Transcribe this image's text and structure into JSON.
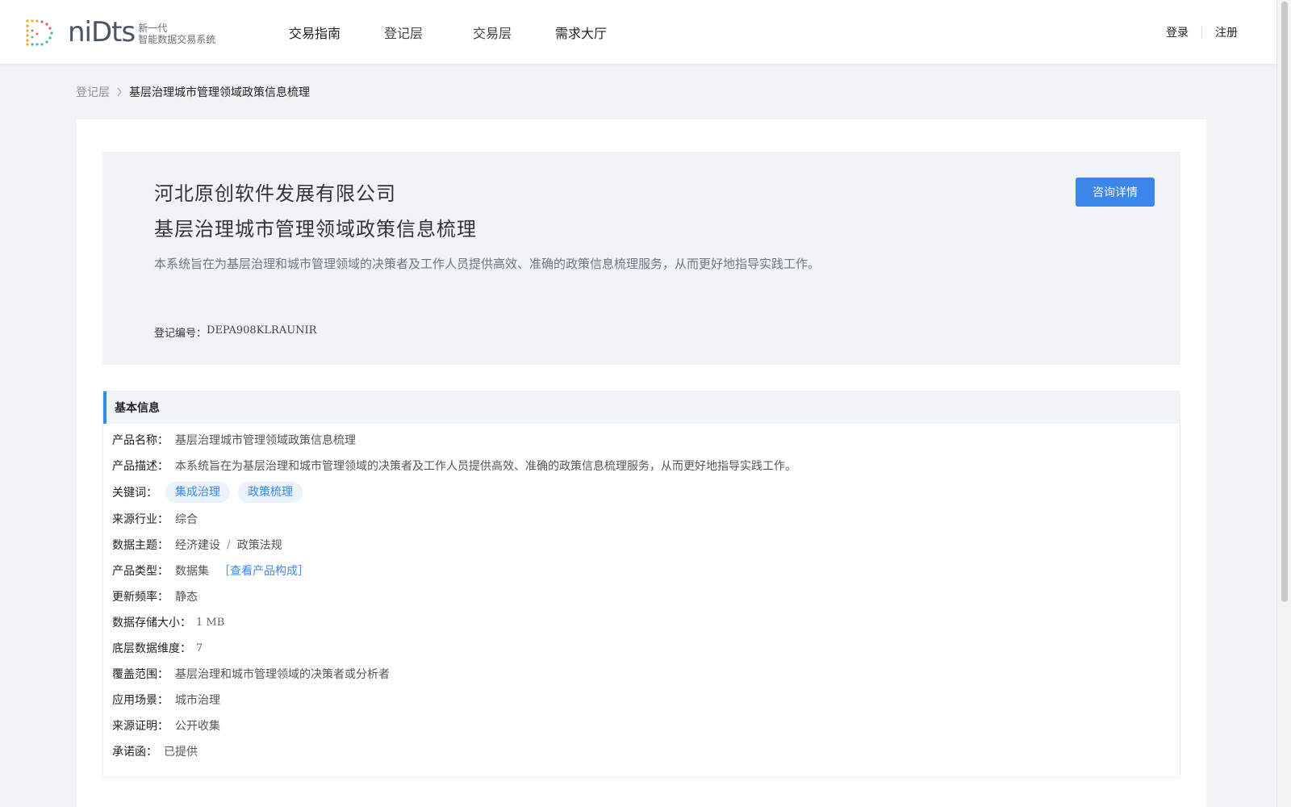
{
  "header": {
    "logo": {
      "icon": "dotted-d-logo-icon",
      "word": "niDts",
      "sub_line1": "新一代",
      "sub_line2": "智能数据交易系统"
    },
    "nav": [
      "交易指南",
      "登记层",
      "交易层",
      "需求大厅"
    ],
    "auth": {
      "login": "登录",
      "register": "注册"
    }
  },
  "breadcrumb": {
    "parent": "登记层",
    "current": "基层治理城市管理领域政策信息梳理",
    "separator_icon": "chevron-right-icon"
  },
  "hero": {
    "company": "河北原创软件发展有限公司",
    "title": "基层治理城市管理领域政策信息梳理",
    "description": "本系统旨在为基层治理和城市管理领域的决策者及工作人员提供高效、准确的政策信息梳理服务，从而更好地指导实践工作。",
    "reg_label": "登记编号：",
    "reg_code": "DEPA908KLRAUNIR",
    "consult_button": "咨询详情"
  },
  "basic_info": {
    "section_title": "基本信息",
    "product_name_label": "产品名称：",
    "product_name": "基层治理城市管理领域政策信息梳理",
    "product_desc_label": "产品描述：",
    "product_desc": "本系统旨在为基层治理和城市管理领域的决策者及工作人员提供高效、准确的政策信息梳理服务，从而更好地指导实践工作。",
    "keywords_label": "关键词：",
    "keywords": [
      "集成治理",
      "政策梳理"
    ],
    "industry_label": "来源行业：",
    "industry": "综合",
    "theme_label": "数据主题：",
    "theme_primary": "经济建设",
    "theme_separator": "/",
    "theme_secondary": "政策法规",
    "type_label": "产品类型：",
    "type": "数据集",
    "type_link": "［查看产品构成］",
    "frequency_label": "更新频率：",
    "frequency": "静态",
    "storage_label": "数据存储大小：",
    "storage": "1 MB",
    "dimension_label": "底层数据维度：",
    "dimension": "7",
    "coverage_label": "覆盖范围：",
    "coverage": "基层治理和城市管理领域的决策者或分析者",
    "scenario_label": "应用场景：",
    "scenario": "城市治理",
    "source_proof_label": "来源证明：",
    "source_proof": "公开收集",
    "commitment_label": "承诺函：",
    "commitment": "已提供"
  },
  "colors": {
    "accent": "#3b86e8",
    "page_bg": "#f2f3f5",
    "hero_bg": "#f1f4f7"
  }
}
